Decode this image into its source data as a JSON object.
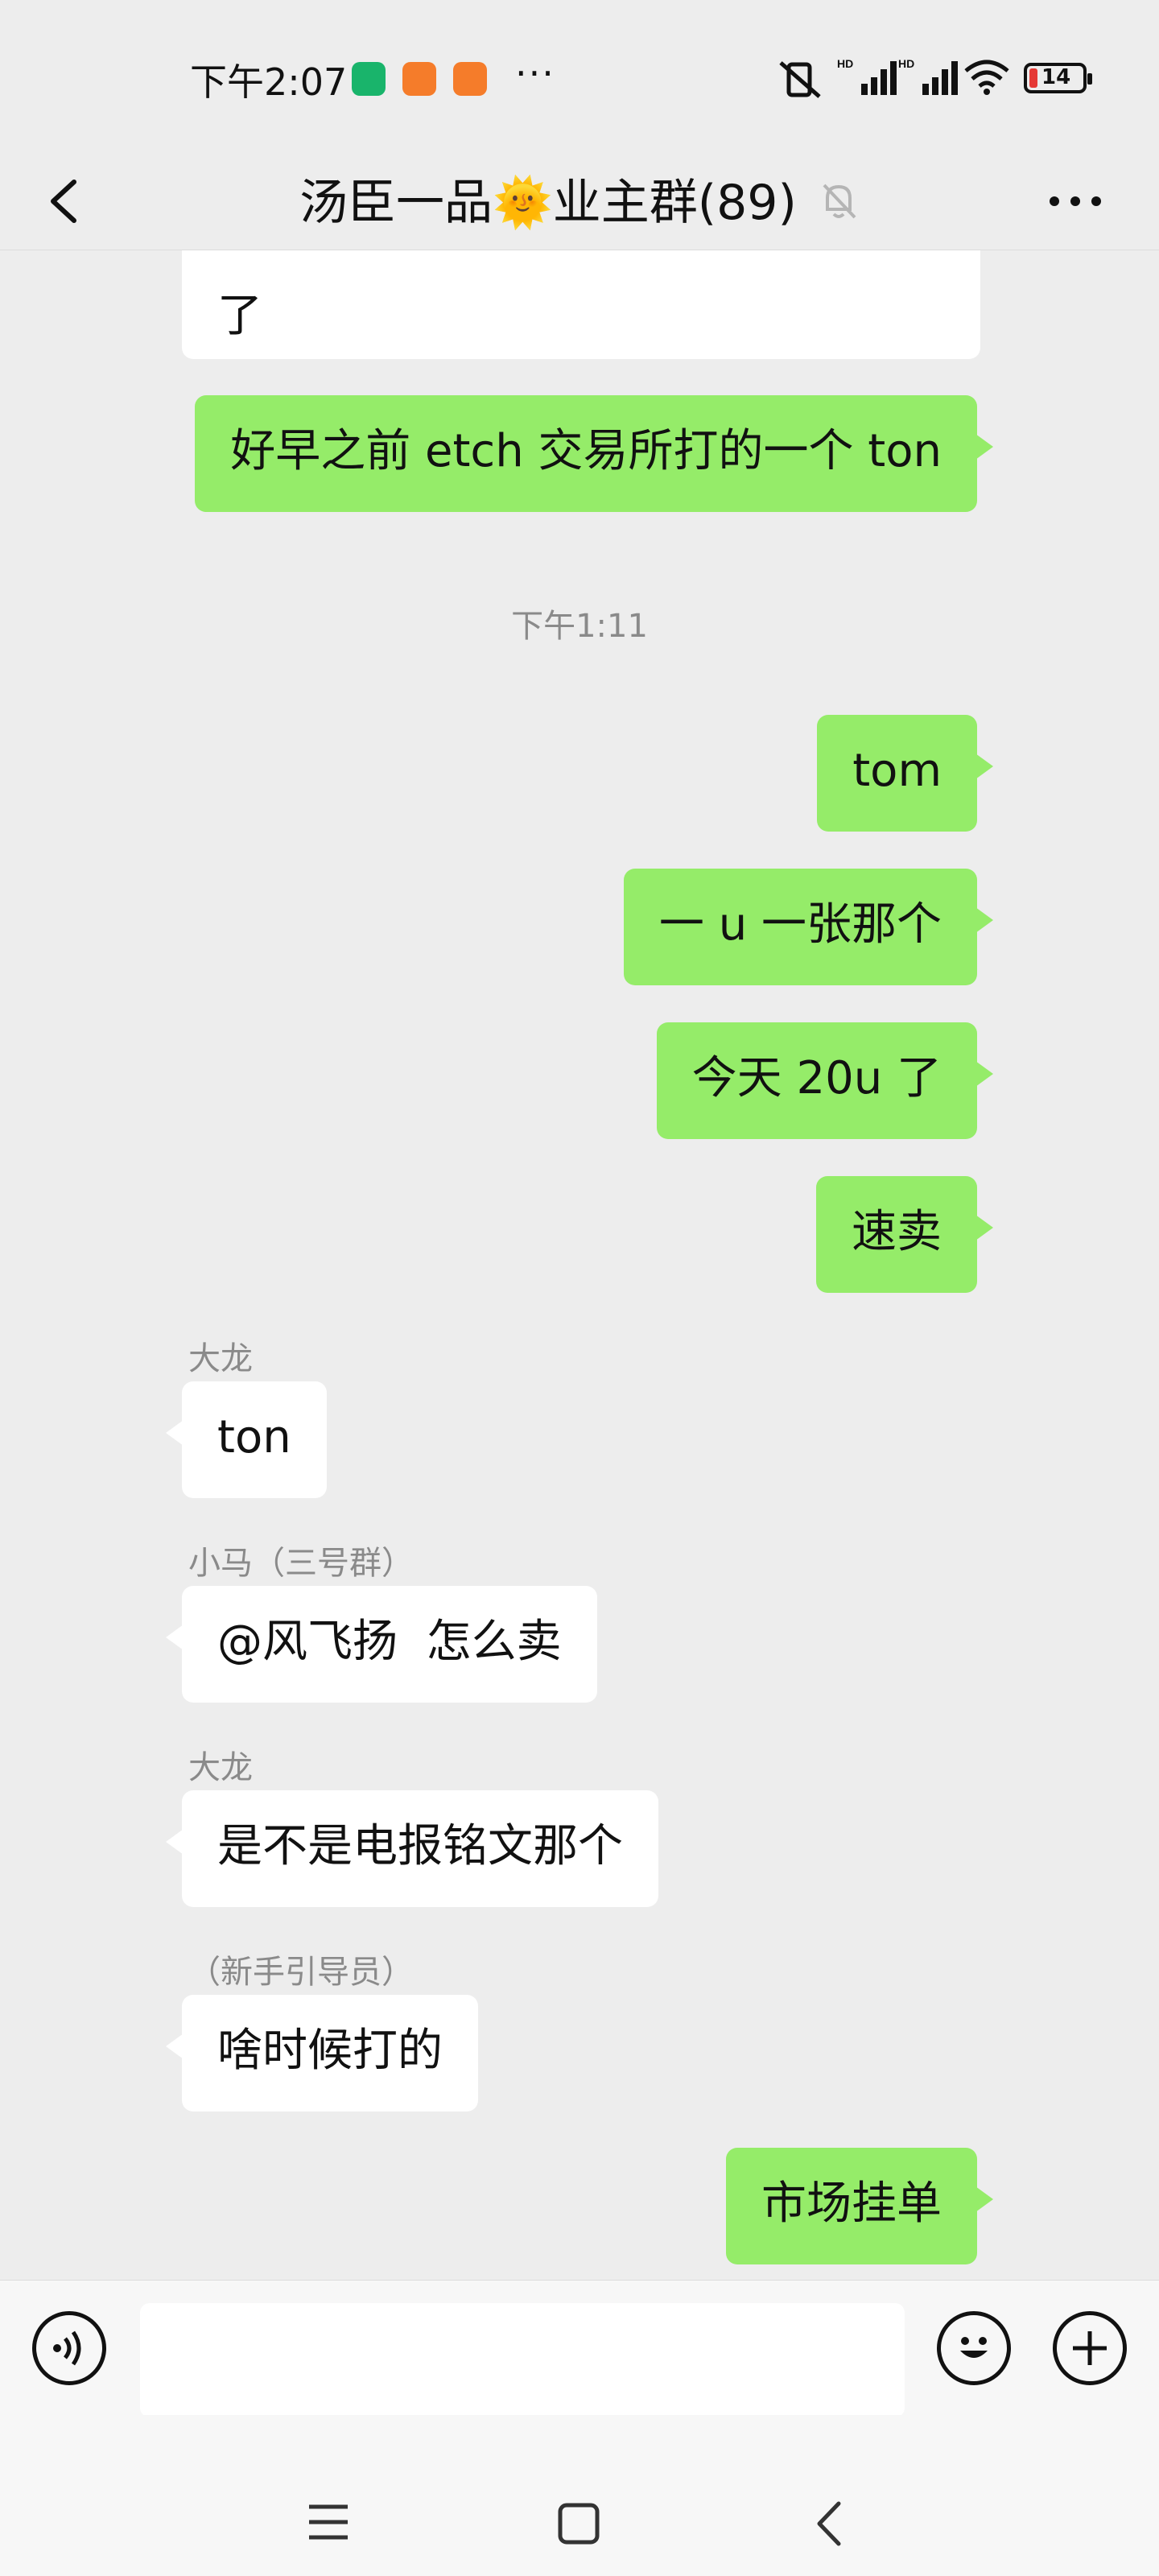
{
  "status_bar": {
    "time": "下午2:07",
    "more": "···",
    "battery": "14"
  },
  "header": {
    "title": "汤臣一品🌞业主群(89)"
  },
  "messages": {
    "m0": "了",
    "m1": "好早之前 etch 交易所打的一个 ton",
    "time1": "下午1:11",
    "m2": "tom",
    "m3": "一 u 一张那个",
    "m4": "今天 20u 了",
    "m5": "速卖",
    "m6_sender": "大龙",
    "m6": "ton",
    "m7_sender": "小马（三号群）",
    "m7": "@风飞扬  怎么卖",
    "m8_sender": "大龙",
    "m8": "是不是电报铭文那个",
    "m9_sender": "（新手引导员）",
    "m9": "啥时候打的",
    "m10": "市场挂单"
  },
  "icons": {
    "back": "chevron-left-icon",
    "mute": "bell-off-icon",
    "more": "more-dots-icon",
    "voice": "voice-icon",
    "emoji": "emoji-icon",
    "add": "plus-icon"
  },
  "colors": {
    "my_bubble": "#95ec69",
    "other_bubble": "#ffffff",
    "background": "#ededed"
  }
}
